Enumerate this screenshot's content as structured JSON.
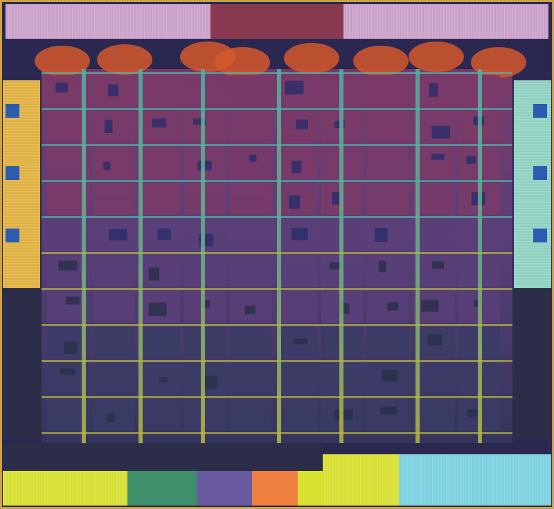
{
  "image": {
    "subject": "die-shot",
    "printed_text": []
  },
  "palette": {
    "frame": "#c9a24a",
    "substrate": "#2a2850",
    "cell_top": "#7a3a68",
    "cell_mid": "#5a3f78",
    "cell_bottom": "#3b3c66",
    "orange_patch": "#d4572a",
    "bus_top": "#4fb3a4",
    "bus_bottom": "#b8b840",
    "io_left": "#e0b040",
    "io_right": "#8fd0c0",
    "io_top": "#c9a0c8",
    "io_bottom_a": "#d8e030",
    "io_bottom_b": "#7ad0e0",
    "io_bottom_c": "#f08040",
    "dark_cell": "#2c2d48"
  }
}
